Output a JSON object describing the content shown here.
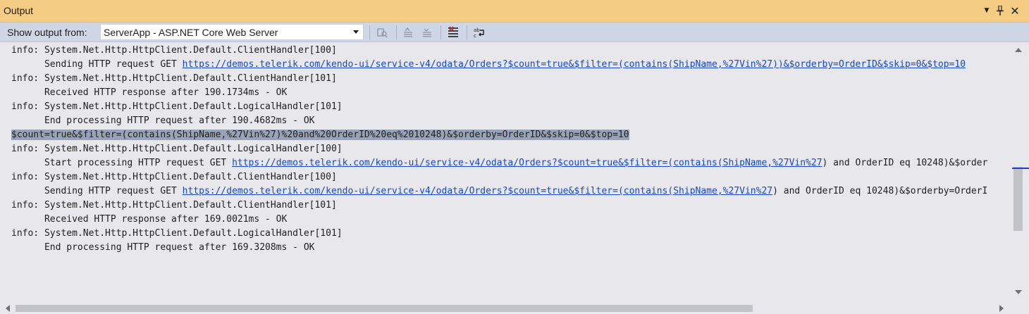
{
  "window": {
    "title": "Output",
    "controls": [
      "dropdown-icon",
      "pin-icon",
      "close-icon"
    ]
  },
  "toolbar": {
    "show_output_label": "Show output from:",
    "source_selected": "ServerApp - ASP.NET Core Web Server",
    "buttons": [
      {
        "name": "find-message-in-code-button",
        "icon": "find-icon",
        "enabled": false
      },
      {
        "name": "go-to-previous-message-button",
        "icon": "prev-message-icon",
        "enabled": false
      },
      {
        "name": "go-to-next-message-button",
        "icon": "next-message-icon",
        "enabled": false
      },
      {
        "name": "clear-all-button",
        "icon": "clear-all-icon",
        "enabled": true
      },
      {
        "name": "toggle-word-wrap-button",
        "icon": "word-wrap-icon",
        "enabled": true
      }
    ]
  },
  "output": {
    "lines": [
      {
        "prefix": "info: System.Net.Http.HttpClient.Default.ClientHandler[100]",
        "link": "",
        "suffix": ""
      },
      {
        "prefix": "      Sending HTTP request GET ",
        "link": "https://demos.telerik.com/kendo-ui/service-v4/odata/Orders?$count=true&$filter=(contains(ShipName,%27Vin%27))&$orderby=OrderID&$skip=0&$top=10",
        "suffix": ""
      },
      {
        "prefix": "info: System.Net.Http.HttpClient.Default.ClientHandler[101]",
        "link": "",
        "suffix": ""
      },
      {
        "prefix": "      Received HTTP response after 190.1734ms - OK",
        "link": "",
        "suffix": ""
      },
      {
        "prefix": "info: System.Net.Http.HttpClient.Default.LogicalHandler[101]",
        "link": "",
        "suffix": ""
      },
      {
        "prefix": "      End processing HTTP request after 190.4682ms - OK",
        "link": "",
        "suffix": ""
      },
      {
        "prefix": "$count=true&$filter=(contains(ShipName,%27Vin%27)%20and%20OrderID%20eq%2010248)&$orderby=OrderID&$skip=0&$top=10",
        "link": "",
        "suffix": "",
        "selected": true
      },
      {
        "prefix": "info: System.Net.Http.HttpClient.Default.LogicalHandler[100]",
        "link": "",
        "suffix": ""
      },
      {
        "prefix": "      Start processing HTTP request GET ",
        "link": "https://demos.telerik.com/kendo-ui/service-v4/odata/Orders?$count=true&$filter=(contains(ShipName,%27Vin%27",
        "suffix": ") and OrderID eq 10248)&$order"
      },
      {
        "prefix": "info: System.Net.Http.HttpClient.Default.ClientHandler[100]",
        "link": "",
        "suffix": ""
      },
      {
        "prefix": "      Sending HTTP request GET ",
        "link": "https://demos.telerik.com/kendo-ui/service-v4/odata/Orders?$count=true&$filter=(contains(ShipName,%27Vin%27",
        "suffix": ") and OrderID eq 10248)&$orderby=OrderI"
      },
      {
        "prefix": "info: System.Net.Http.HttpClient.Default.ClientHandler[101]",
        "link": "",
        "suffix": ""
      },
      {
        "prefix": "      Received HTTP response after 169.0021ms - OK",
        "link": "",
        "suffix": ""
      },
      {
        "prefix": "info: System.Net.Http.HttpClient.Default.LogicalHandler[101]",
        "link": "",
        "suffix": ""
      },
      {
        "prefix": "      End processing HTTP request after 169.3208ms - OK",
        "link": "",
        "suffix": ""
      }
    ]
  },
  "colors": {
    "titlebar": "#f5cc84",
    "toolbar": "#cfd6e5",
    "content_bg": "#e8e8ec",
    "selection": "#99a3b8",
    "link": "#1747c4"
  }
}
